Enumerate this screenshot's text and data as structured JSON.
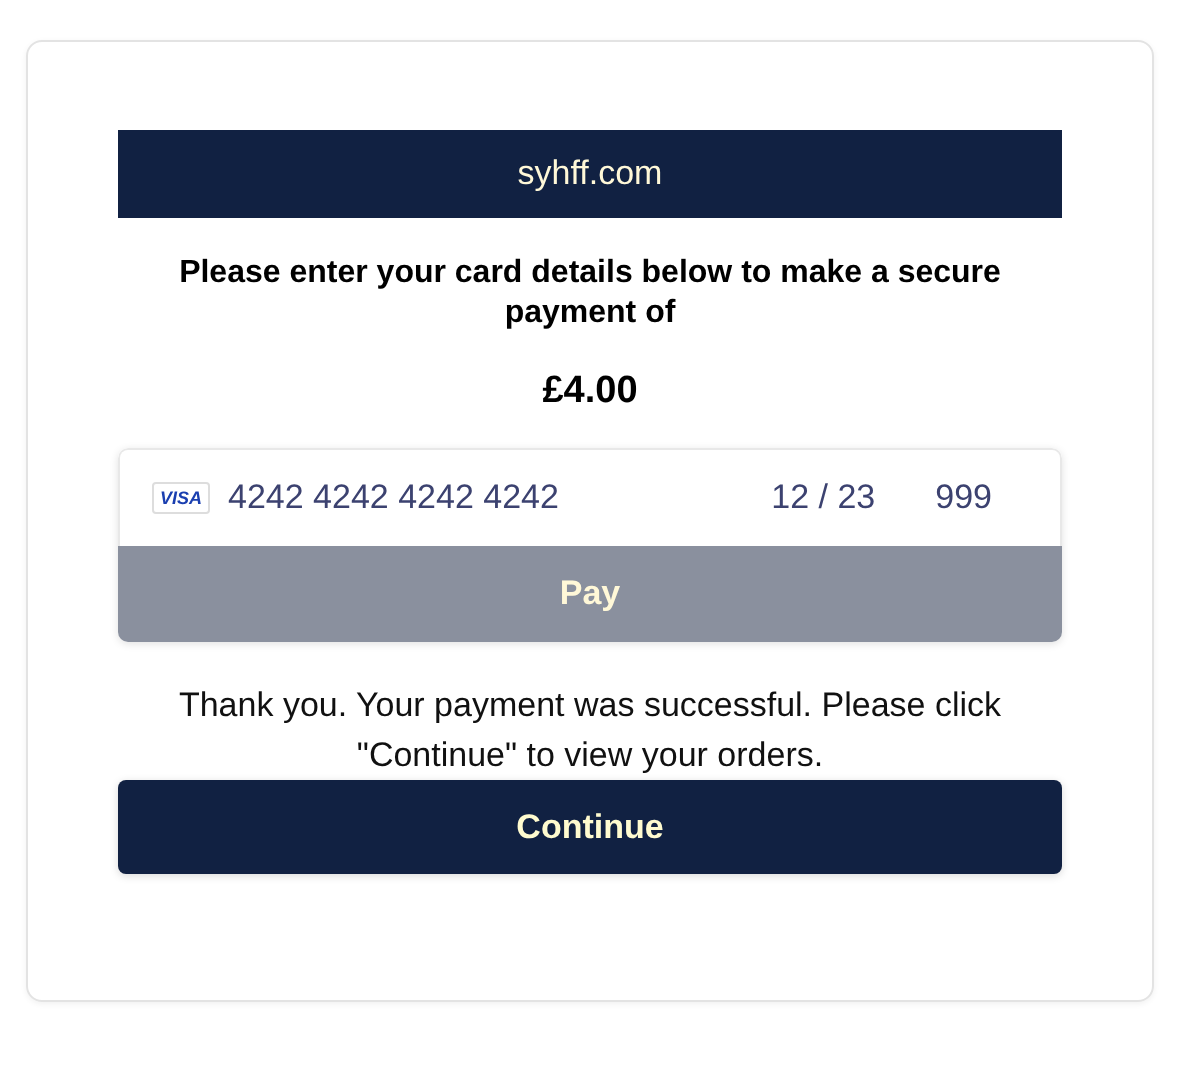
{
  "header": {
    "site": "syhff.com"
  },
  "prompt": "Please enter your card details below to make a secure payment of",
  "amount": "£4.00",
  "card": {
    "brand": "VISA",
    "number": "4242 4242 4242 4242",
    "expiry": "12 / 23",
    "cvc": "999"
  },
  "pay_button": {
    "label": "Pay",
    "disabled": true
  },
  "message": "Thank you. Your payment was successful. Please click \"Continue\" to view your orders.",
  "continue_button": {
    "label": "Continue",
    "disabled": false
  }
}
